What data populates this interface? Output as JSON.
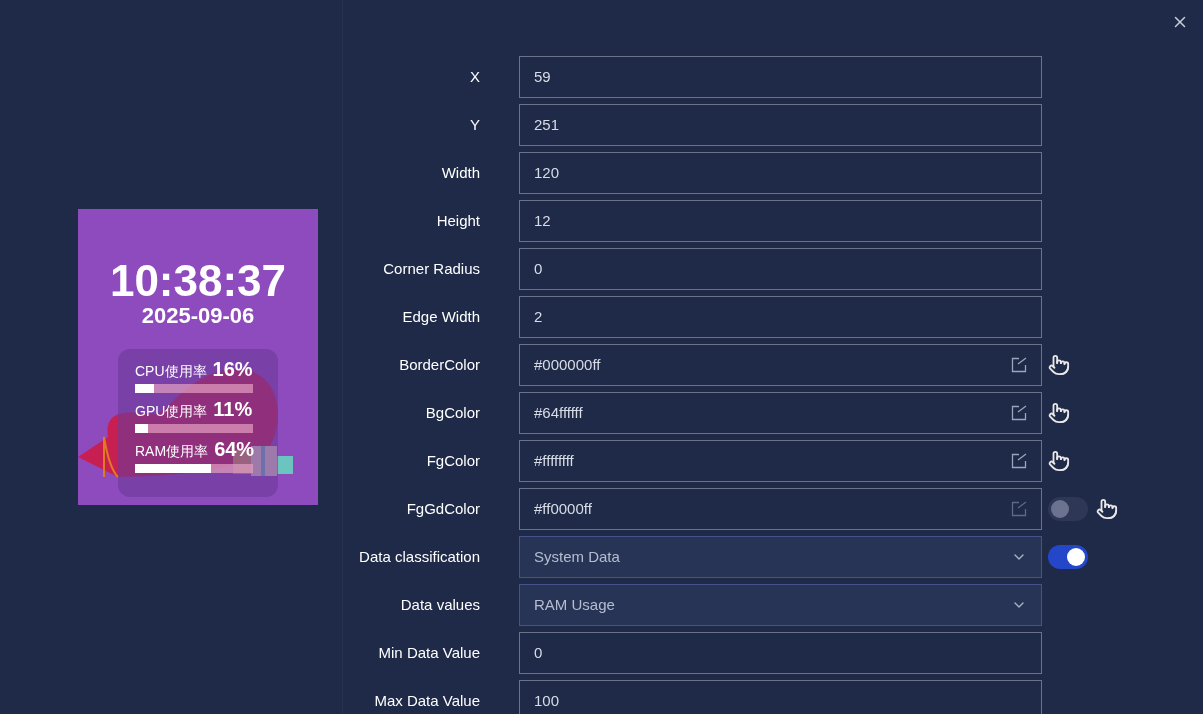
{
  "preview": {
    "time": "10:38:37",
    "date": "2025-09-06",
    "meters": [
      {
        "label": "CPU使用率",
        "value": "16%",
        "level": 0.16
      },
      {
        "label": "GPU使用率",
        "value": "11%",
        "level": 0.11
      },
      {
        "label": "RAM使用率",
        "value": "64%",
        "level": 0.64
      }
    ]
  },
  "fields": [
    {
      "kind": "text",
      "label": "X",
      "value": "59"
    },
    {
      "kind": "text",
      "label": "Y",
      "value": "251"
    },
    {
      "kind": "text",
      "label": "Width",
      "value": "120"
    },
    {
      "kind": "text",
      "label": "Height",
      "value": "12"
    },
    {
      "kind": "text",
      "label": "Corner Radius",
      "value": "0"
    },
    {
      "kind": "text",
      "label": "Edge Width",
      "value": "2"
    },
    {
      "kind": "color",
      "label": "BorderColor",
      "value": "#000000ff"
    },
    {
      "kind": "color",
      "label": "BgColor",
      "value": "#64ffffff"
    },
    {
      "kind": "color",
      "label": "FgColor",
      "value": "#ffffffff"
    },
    {
      "kind": "color",
      "label": "FgGdColor",
      "value": "#ff0000ff",
      "toggle": {
        "on": false
      }
    },
    {
      "kind": "select",
      "label": "Data classification",
      "value": "System Data",
      "toggle": {
        "on": true
      }
    },
    {
      "kind": "select",
      "label": "Data values",
      "value": "RAM Usage"
    },
    {
      "kind": "text",
      "label": "Min Data Value",
      "value": "0"
    },
    {
      "kind": "text",
      "label": "Max Data Value",
      "value": "100"
    }
  ]
}
